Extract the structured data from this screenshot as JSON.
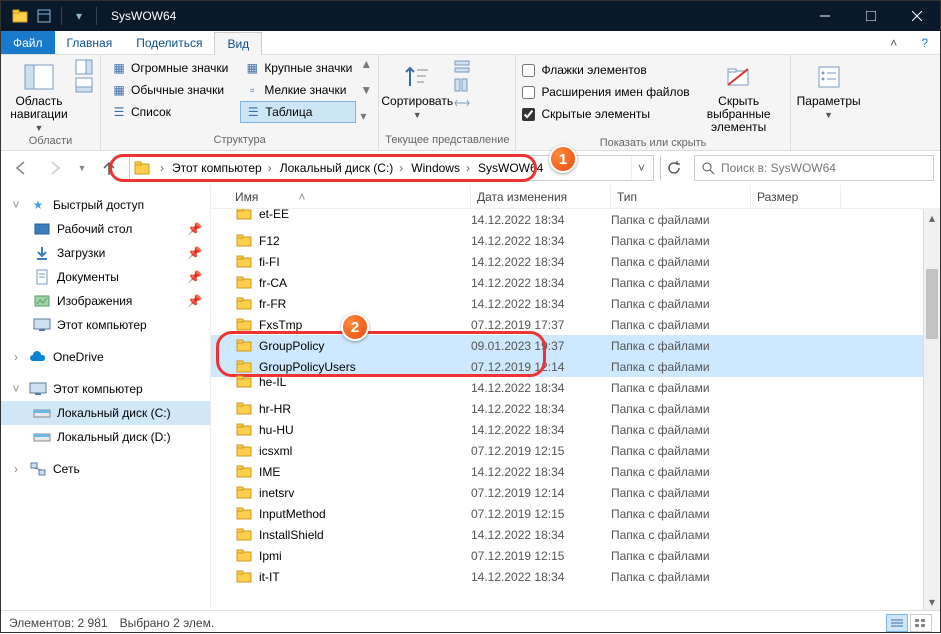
{
  "window": {
    "title": "SysWOW64"
  },
  "menubar": {
    "file": "Файл",
    "main": "Главная",
    "share": "Поделиться",
    "view": "Вид"
  },
  "ribbon": {
    "panes": {
      "nav": {
        "title": "Область навигации",
        "group_label": "Области"
      }
    },
    "layout": {
      "huge": "Огромные значки",
      "large": "Крупные значки",
      "medium": "Обычные значки",
      "small": "Мелкие значки",
      "list": "Список",
      "table": "Таблица",
      "group_label": "Структура"
    },
    "view": {
      "sort": "Сортировать",
      "group_label": "Текущее представление"
    },
    "showhide": {
      "chk_item_checkboxes": "Флажки элементов",
      "chk_extensions": "Расширения имен файлов",
      "chk_hidden": "Скрытые элементы",
      "hide_selected": "Скрыть выбранные элементы",
      "group_label": "Показать или скрыть"
    },
    "options": {
      "label": "Параметры"
    }
  },
  "breadcrumb": [
    "Этот компьютер",
    "Локальный диск (C:)",
    "Windows",
    "SysWOW64"
  ],
  "search": {
    "placeholder": "Поиск в: SysWOW64"
  },
  "nav": {
    "quick": {
      "label": "Быстрый доступ",
      "items": [
        "Рабочий стол",
        "Загрузки",
        "Документы",
        "Изображения",
        "Этот компьютер"
      ]
    },
    "onedrive": "OneDrive",
    "thispc": {
      "label": "Этот компьютер",
      "items": [
        "Локальный диск (C:)",
        "Локальный диск (D:)"
      ]
    },
    "network": "Сеть"
  },
  "columns": {
    "name": "Имя",
    "date": "Дата изменения",
    "type": "Тип",
    "size": "Размер"
  },
  "type_folder": "Папка с файлами",
  "files": [
    {
      "name": "et-EE",
      "date": "14.12.2022 18:34",
      "cut": true
    },
    {
      "name": "F12",
      "date": "14.12.2022 18:34"
    },
    {
      "name": "fi-FI",
      "date": "14.12.2022 18:34"
    },
    {
      "name": "fr-CA",
      "date": "14.12.2022 18:34"
    },
    {
      "name": "fr-FR",
      "date": "14.12.2022 18:34"
    },
    {
      "name": "FxsTmp",
      "date": "07.12.2019 17:37"
    },
    {
      "name": "GroupPolicy",
      "date": "09.01.2023 19:37",
      "selected": true
    },
    {
      "name": "GroupPolicyUsers",
      "date": "07.12.2019 12:14",
      "selected": true
    },
    {
      "name": "he-IL",
      "date": "14.12.2022 18:34",
      "cut": true
    },
    {
      "name": "hr-HR",
      "date": "14.12.2022 18:34"
    },
    {
      "name": "hu-HU",
      "date": "14.12.2022 18:34"
    },
    {
      "name": "icsxml",
      "date": "07.12.2019 12:15"
    },
    {
      "name": "IME",
      "date": "14.12.2022 18:34"
    },
    {
      "name": "inetsrv",
      "date": "07.12.2019 12:14"
    },
    {
      "name": "InputMethod",
      "date": "07.12.2019 12:15"
    },
    {
      "name": "InstallShield",
      "date": "14.12.2022 18:34"
    },
    {
      "name": "Ipmi",
      "date": "07.12.2019 12:15"
    },
    {
      "name": "it-IT",
      "date": "14.12.2022 18:34"
    }
  ],
  "status": {
    "count_label": "Элементов:",
    "count": "2 981",
    "selected_label": "Выбрано 2 элем."
  },
  "annotations": {
    "one": "1",
    "two": "2"
  }
}
